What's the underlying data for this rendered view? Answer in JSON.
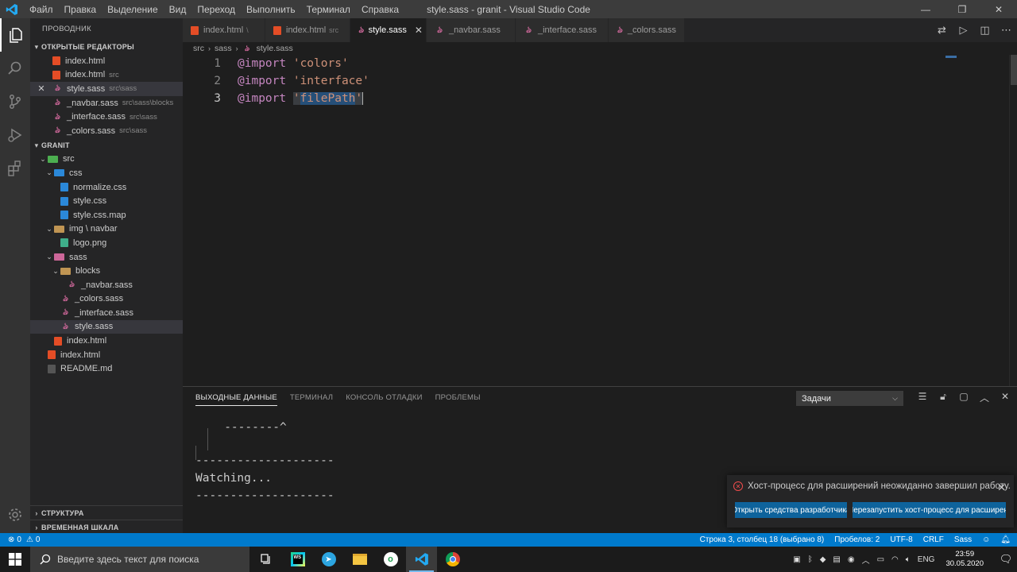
{
  "window": {
    "title": "style.sass - granit - Visual Studio Code",
    "menu": [
      "Файл",
      "Правка",
      "Выделение",
      "Вид",
      "Переход",
      "Выполнить",
      "Терминал",
      "Справка"
    ],
    "controls": [
      "—",
      "❐",
      "✕"
    ]
  },
  "activity_bar": [
    "explorer-icon",
    "search-icon",
    "source-control-icon",
    "run-debug-icon",
    "extensions-icon",
    "settings-gear-icon"
  ],
  "sidebar": {
    "header": "ПРОВОДНИК",
    "open_editors_title": "ОТКРЫТЫЕ РЕДАКТОРЫ",
    "open_editors": [
      {
        "name": "index.html",
        "desc": "",
        "icon": "html"
      },
      {
        "name": "index.html",
        "desc": "src",
        "icon": "html"
      },
      {
        "name": "style.sass",
        "desc": "src\\sass",
        "icon": "sass",
        "selected": true
      },
      {
        "name": "_navbar.sass",
        "desc": "src\\sass\\blocks",
        "icon": "sass"
      },
      {
        "name": "_interface.sass",
        "desc": "src\\sass",
        "icon": "sass"
      },
      {
        "name": "_colors.sass",
        "desc": "src\\sass",
        "icon": "sass"
      }
    ],
    "workspace_title": "GRANIT",
    "tree": [
      {
        "name": "src",
        "depth": 1,
        "type": "folder-src",
        "open": true
      },
      {
        "name": "css",
        "depth": 2,
        "type": "folder-css",
        "open": true
      },
      {
        "name": "normalize.css",
        "depth": 3,
        "type": "css"
      },
      {
        "name": "style.css",
        "depth": 3,
        "type": "css"
      },
      {
        "name": "style.css.map",
        "depth": 3,
        "type": "css"
      },
      {
        "name": "img \\ navbar",
        "depth": 2,
        "type": "folder-img",
        "open": true
      },
      {
        "name": "logo.png",
        "depth": 3,
        "type": "png"
      },
      {
        "name": "sass",
        "depth": 2,
        "type": "folder-sass",
        "open": true
      },
      {
        "name": "blocks",
        "depth": 3,
        "type": "folder",
        "open": true
      },
      {
        "name": "_navbar.sass",
        "depth": 4,
        "type": "sass"
      },
      {
        "name": "_colors.sass",
        "depth": 3,
        "type": "sass"
      },
      {
        "name": "_interface.sass",
        "depth": 3,
        "type": "sass"
      },
      {
        "name": "style.sass",
        "depth": 3,
        "type": "sass",
        "selected": true
      },
      {
        "name": "index.html",
        "depth": 2,
        "type": "html"
      },
      {
        "name": "index.html",
        "depth": 1,
        "type": "html"
      },
      {
        "name": "README.md",
        "depth": 1,
        "type": "md"
      }
    ],
    "outline_title": "СТРУКТУРА",
    "timeline_title": "ВРЕМЕННАЯ ШКАЛА"
  },
  "tabs": [
    {
      "name": "index.html",
      "desc": "\\",
      "icon": "html"
    },
    {
      "name": "index.html",
      "desc": "src",
      "icon": "html"
    },
    {
      "name": "style.sass",
      "desc": "",
      "icon": "sass",
      "active": true
    },
    {
      "name": "_navbar.sass",
      "desc": "",
      "icon": "sass"
    },
    {
      "name": "_interface.sass",
      "desc": "",
      "icon": "sass"
    },
    {
      "name": "_colors.sass",
      "desc": "",
      "icon": "sass"
    }
  ],
  "breadcrumb": [
    "src",
    "sass",
    "style.sass"
  ],
  "code": [
    {
      "num": "1",
      "kw": "@import",
      "q1": "'",
      "str": "colors",
      "q2": "'"
    },
    {
      "num": "2",
      "kw": "@import",
      "q1": "'",
      "str": "interface",
      "q2": "'"
    },
    {
      "num": "3",
      "kw": "@import",
      "q1": "'",
      "str": "filePath",
      "q2": "'"
    }
  ],
  "panel": {
    "tabs": [
      "ВЫХОДНЫЕ ДАННЫЕ",
      "ТЕРМИНАЛ",
      "КОНСОЛЬ ОТЛАДКИ",
      "ПРОБЛЕМЫ"
    ],
    "select_value": "Задачи",
    "output": [
      "   --------^",
      "--------------------",
      "Watching...",
      "--------------------"
    ]
  },
  "notification": {
    "message": "Хост-процесс для расширений неожиданно завершил работу.",
    "button1": "Открыть средства разработчика",
    "button2": "Перезапустить хост-процесс для расширений"
  },
  "status_bar": {
    "errors": "0",
    "warnings": "0",
    "position": "Строка 3, столбец 18 (выбрано 8)",
    "spaces": "Пробелов: 2",
    "encoding": "UTF-8",
    "eol": "CRLF",
    "language": "Sass"
  },
  "taskbar": {
    "search_placeholder": "Введите здесь текст для поиска",
    "lang": "ENG",
    "time": "23:59",
    "date": "30.05.2020"
  }
}
